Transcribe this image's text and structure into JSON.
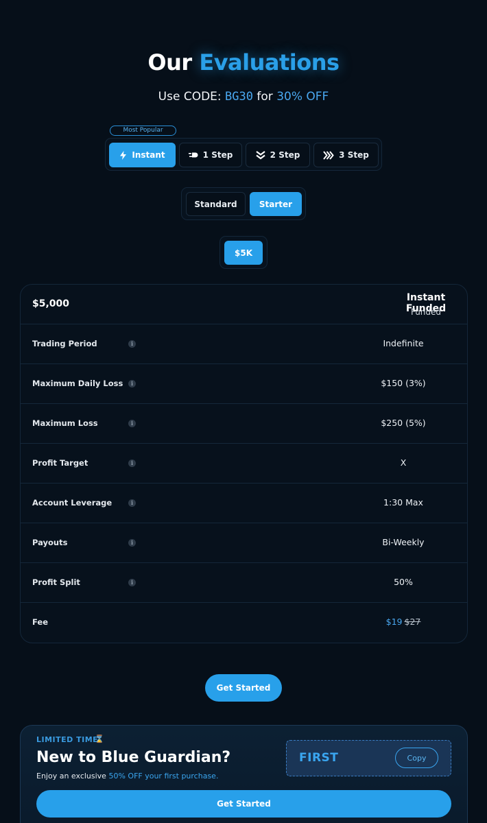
{
  "header": {
    "title_prefix": "Our",
    "title_accent": "Evaluations",
    "promo_prefix": "Use CODE:",
    "promo_code": "BG30",
    "promo_for": "for",
    "promo_discount": "30% OFF"
  },
  "badge": "Most Popular",
  "tabs": [
    {
      "label": "Instant",
      "icon": "lightning-icon",
      "active": true
    },
    {
      "label": "1 Step",
      "icon": "dash-arrow-icon",
      "active": false
    },
    {
      "label": "2 Step",
      "icon": "double-chevron-down-icon",
      "active": false
    },
    {
      "label": "3 Step",
      "icon": "triple-chevron-right-icon",
      "active": false
    }
  ],
  "variants": [
    {
      "label": "Standard",
      "active": false
    },
    {
      "label": "Starter",
      "active": true
    }
  ],
  "sizes": [
    {
      "label": "$5K",
      "active": true
    }
  ],
  "table": {
    "amount": "$5,000",
    "plan_name": "Instant Funded",
    "plan_sub": "Funded",
    "rows": [
      {
        "label": "Trading Period",
        "value": "Indefinite"
      },
      {
        "label": "Maximum Daily Loss",
        "value": "$150 (3%)"
      },
      {
        "label": "Maximum Loss",
        "value": "$250 (5%)"
      },
      {
        "label": "Profit Target",
        "value": "X"
      },
      {
        "label": "Account Leverage",
        "value": "1:30 Max"
      },
      {
        "label": "Payouts",
        "value": "Bi-Weekly"
      },
      {
        "label": "Profit Split",
        "value": "50%"
      }
    ],
    "fee_label": "Fee",
    "fee_price": "$19",
    "fee_old_price": "$27",
    "info_glyph": "i"
  },
  "cta": "Get Started",
  "promo_card": {
    "limited": "LIMITED TIME",
    "hourglass": "⌛",
    "headline": "New to Blue Guardian?",
    "desc_prefix": "Enjoy an exclusive",
    "desc_highlight": "50% OFF your first purchase.",
    "code": "FIRST",
    "copy_label": "Copy",
    "cta": "Get Started"
  },
  "colors": {
    "background": "#060f19",
    "accent": "#28a0ea",
    "accent_text": "#4aa8f0",
    "border": "#14273a"
  }
}
